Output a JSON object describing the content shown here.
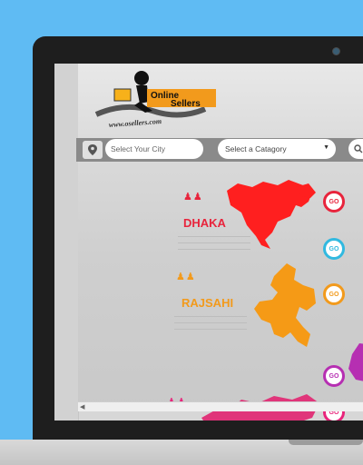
{
  "brand": {
    "name_line1": "Online",
    "name_line2": "Sellers",
    "url": "www.osellers.com",
    "accent": "#f29a1c"
  },
  "search": {
    "city_placeholder": "Select Your City",
    "category_placeholder": "Select a Catagory",
    "category_arrow": "▼"
  },
  "regions": [
    {
      "name": "DHAKA",
      "color": "#ff1f1f",
      "go_label": "GO",
      "go_color": "#e8243c"
    },
    {
      "name": "RAJSAHI",
      "color": "#f59a16",
      "go_label": "GO",
      "go_color": "#f29a1c"
    },
    {
      "name": "",
      "color": "#e0357a",
      "go_label": "GO",
      "go_color": "#e8247b"
    }
  ],
  "side_go_buttons": [
    {
      "label": "GO",
      "color": "#31b9e0"
    },
    {
      "label": "GO",
      "color": "#b62fb2"
    }
  ],
  "icons": {
    "pin": "map-pin-icon",
    "search": "search-icon",
    "people": "people-icon"
  }
}
